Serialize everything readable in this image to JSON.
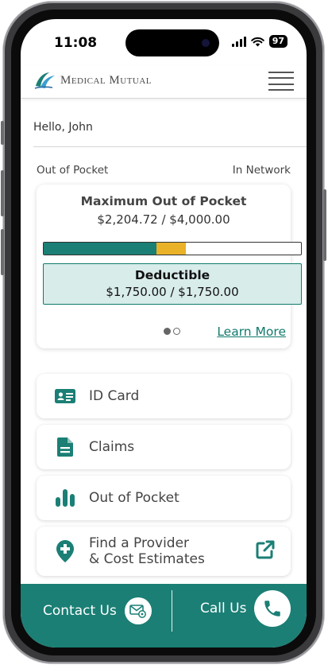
{
  "status_bar": {
    "time": "11:08",
    "battery": "97"
  },
  "header": {
    "brand_name": "Medical Mutual",
    "menu_icon": "hamburger-menu-icon"
  },
  "greeting": "Hello, John",
  "out_of_pocket_row": {
    "left_label": "Out of Pocket",
    "right_label": "In Network"
  },
  "summary_card": {
    "title": "Maximum Out of Pocket",
    "amount": "$2,204.72 / $4,000.00",
    "progress": {
      "segments": [
        {
          "fraction": 0.4375,
          "color": "#1b7f75"
        },
        {
          "fraction": 0.1137,
          "color": "#e9b229"
        }
      ]
    },
    "deductible": {
      "title": "Deductible",
      "amount": "$1,750.00 / $1,750.00"
    },
    "pager": {
      "total": 2,
      "active": 1
    },
    "learn_more_label": "Learn More"
  },
  "nav_items": [
    {
      "label": "ID Card",
      "icon": "id-card-icon"
    },
    {
      "label": "Claims",
      "icon": "document-icon"
    },
    {
      "label": "Out of Pocket",
      "icon": "bar-chart-icon"
    },
    {
      "label_line1": "Find a Provider",
      "label_line2": "& Cost Estimates",
      "icon": "medical-location-pin-icon",
      "trailing_icon": "external-link-icon"
    }
  ],
  "footer": {
    "contact_label": "Contact Us",
    "contact_icon": "email-icon",
    "call_label": "Call Us",
    "call_icon": "phone-icon"
  },
  "colors": {
    "brand_teal": "#1b7f75",
    "link_teal": "#117a6d",
    "accent_gold": "#e9b229",
    "deductible_bg": "#d8ecea"
  }
}
